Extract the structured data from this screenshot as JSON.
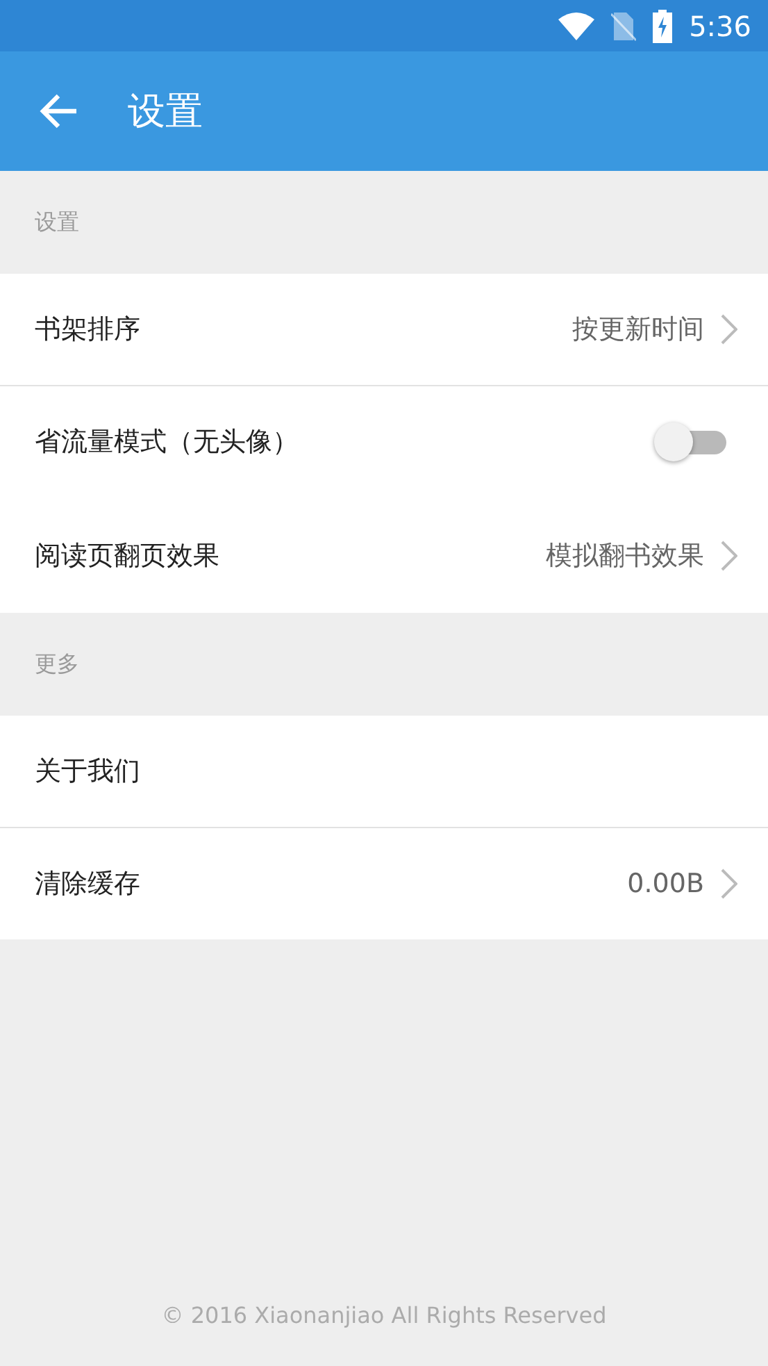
{
  "status_bar": {
    "time": "5:36"
  },
  "app_bar": {
    "title": "设置"
  },
  "sections": [
    {
      "header": "设置",
      "groups": [
        [
          {
            "kind": "value",
            "label": "书架排序",
            "value": "按更新时间"
          }
        ],
        [
          {
            "kind": "toggle",
            "label": "省流量模式（无头像）",
            "on": false
          },
          {
            "kind": "value",
            "label": "阅读页翻页效果",
            "value": "模拟翻书效果"
          }
        ]
      ]
    },
    {
      "header": "更多",
      "groups": [
        [
          {
            "kind": "plain",
            "label": "关于我们"
          }
        ],
        [
          {
            "kind": "value",
            "label": "清除缓存",
            "value": "0.00B"
          }
        ]
      ]
    }
  ],
  "footer": "© 2016 Xiaonanjiao All Rights Reserved"
}
